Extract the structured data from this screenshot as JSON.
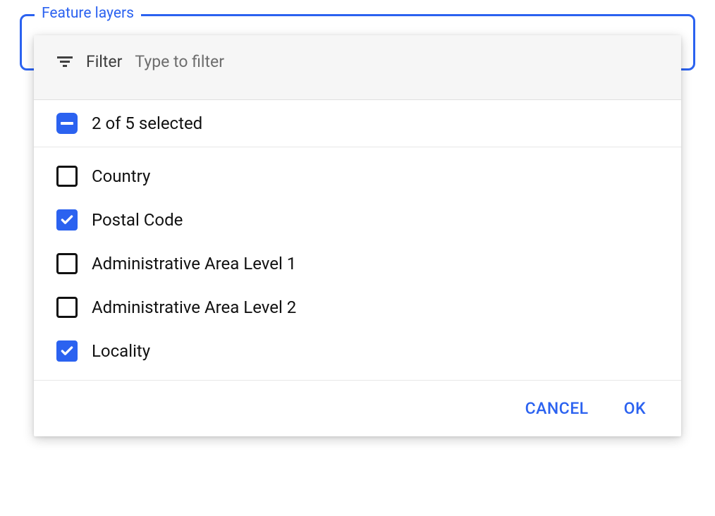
{
  "fieldset": {
    "legend": "Feature layers"
  },
  "filter": {
    "label": "Filter",
    "placeholder": "Type to filter"
  },
  "summary": {
    "text": "2 of 5 selected"
  },
  "options": [
    {
      "label": "Country",
      "checked": false
    },
    {
      "label": "Postal Code",
      "checked": true
    },
    {
      "label": "Administrative Area Level 1",
      "checked": false
    },
    {
      "label": "Administrative Area Level 2",
      "checked": false
    },
    {
      "label": "Locality",
      "checked": true
    }
  ],
  "footer": {
    "cancel": "CANCEL",
    "ok": "OK"
  }
}
